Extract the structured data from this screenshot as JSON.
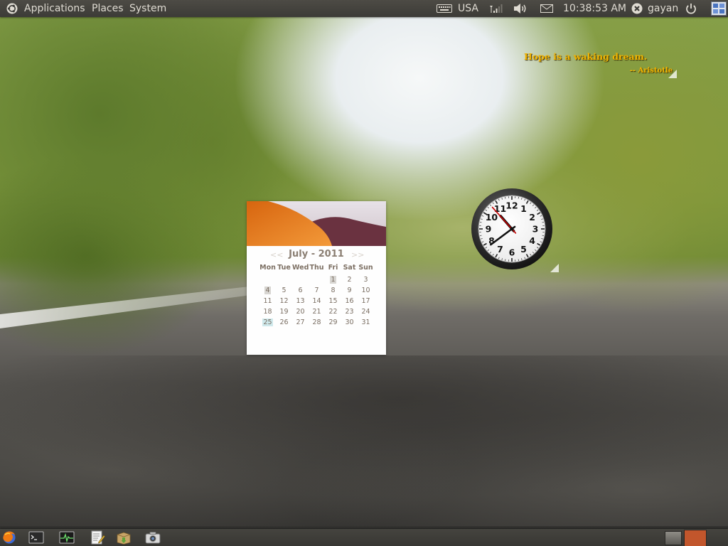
{
  "top_panel": {
    "menus": {
      "applications": "Applications",
      "places": "Places",
      "system": "System"
    },
    "keyboard_layout": "USA",
    "clock": "10:38:53 AM",
    "user": "gayan"
  },
  "quote_gadget": {
    "text": "Hope is a waking dream.",
    "author": "-- Aristotle"
  },
  "calendar_gadget": {
    "prev": "<<",
    "next": ">>",
    "title": "July - 2011",
    "days_of_week": [
      "Mon",
      "Tue",
      "Wed",
      "Thu",
      "Fri",
      "Sat",
      "Sun"
    ],
    "weeks": [
      [
        "",
        "",
        "",
        "",
        "1",
        "2",
        "3"
      ],
      [
        "4",
        "5",
        "6",
        "7",
        "8",
        "9",
        "10"
      ],
      [
        "11",
        "12",
        "13",
        "14",
        "15",
        "16",
        "17"
      ],
      [
        "18",
        "19",
        "20",
        "21",
        "22",
        "23",
        "24"
      ],
      [
        "25",
        "26",
        "27",
        "28",
        "29",
        "30",
        "31"
      ]
    ],
    "marked_days": [
      "1",
      "4"
    ],
    "highlighted_day": "25"
  },
  "analog_clock": {
    "hour": 10,
    "minute": 38,
    "second": 53,
    "numerals": [
      "12",
      "1",
      "2",
      "3",
      "4",
      "5",
      "6",
      "7",
      "8",
      "9",
      "10",
      "11"
    ]
  },
  "bottom_panel": {
    "launchers": [
      "firefox-icon",
      "terminal-icon",
      "system-monitor-icon",
      "text-editor-icon",
      "archive-manager-icon",
      "screenshot-icon"
    ]
  },
  "colors": {
    "panel_bg": "#3c3b37",
    "panel_text": "#dfdbd2",
    "quote_text": "#f2b400",
    "calendar_text": "#7a6e62",
    "calendar_today": "#cfe9ec",
    "clock_second_hand": "#c40000",
    "workspace_active": "#c2562c"
  }
}
